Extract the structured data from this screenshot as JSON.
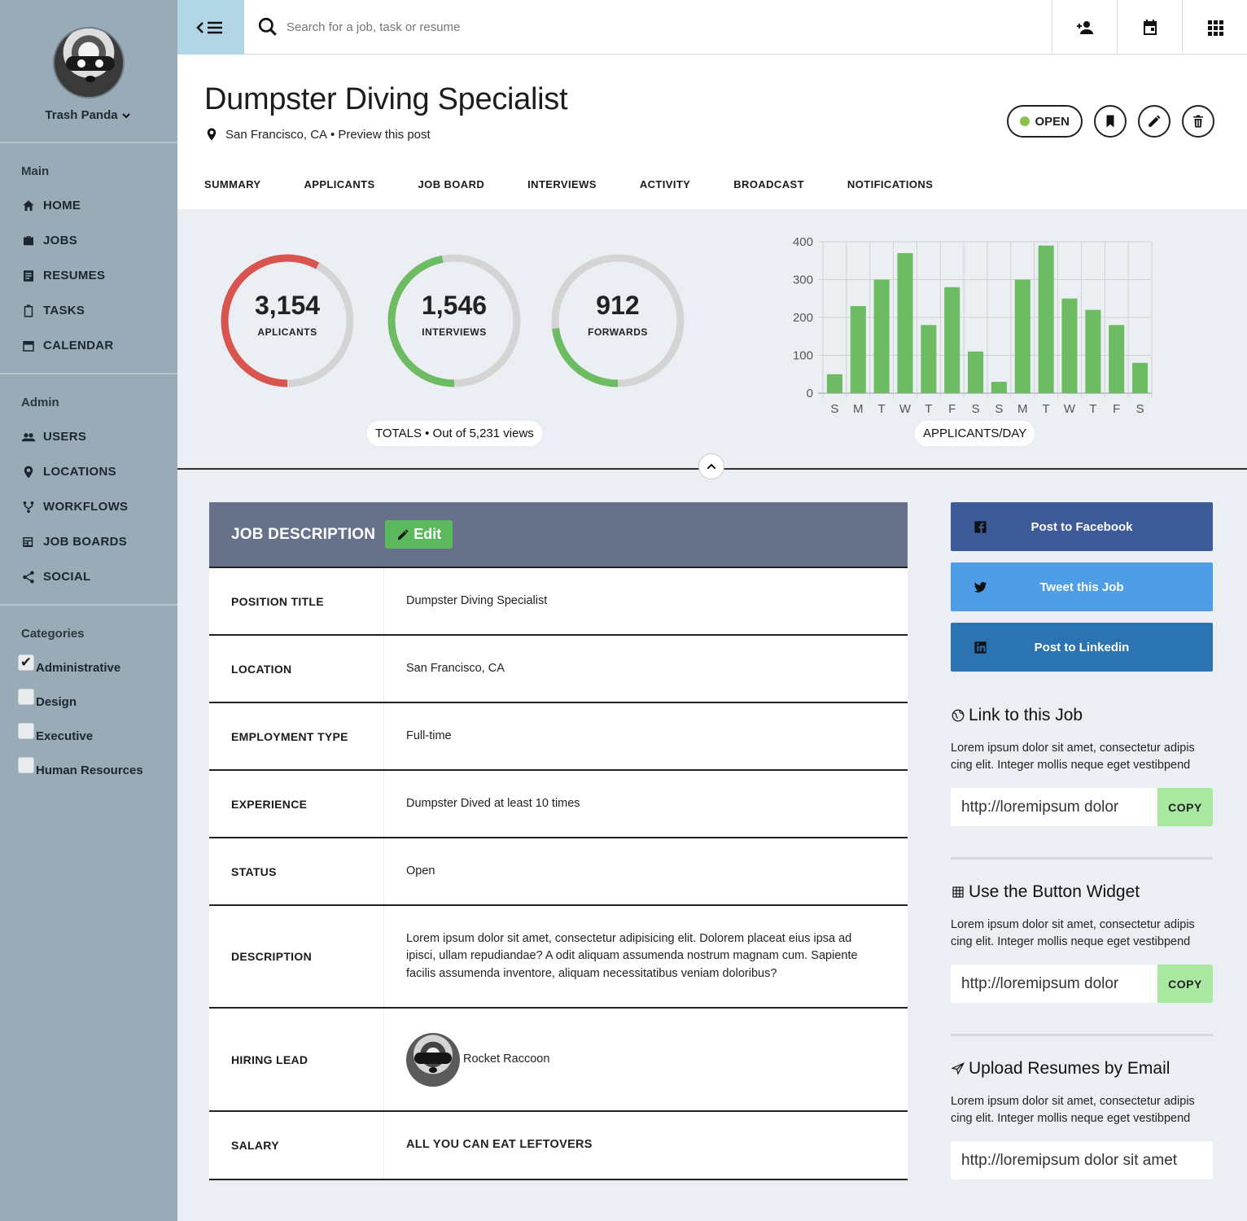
{
  "user": {
    "name": "Trash Panda"
  },
  "sidebar": {
    "main_title": "Main",
    "main_items": [
      {
        "label": "HOME",
        "icon": "home-icon"
      },
      {
        "label": "JOBS",
        "icon": "briefcase-icon"
      },
      {
        "label": "RESUMES",
        "icon": "document-icon"
      },
      {
        "label": "TASKS",
        "icon": "clipboard-icon"
      },
      {
        "label": "CALENDAR",
        "icon": "calendar-icon"
      }
    ],
    "admin_title": "Admin",
    "admin_items": [
      {
        "label": "USERS",
        "icon": "users-icon"
      },
      {
        "label": "LOCATIONS",
        "icon": "location-pin-icon"
      },
      {
        "label": "WORKFLOWS",
        "icon": "workflow-icon"
      },
      {
        "label": "JOB BOARDS",
        "icon": "newspaper-icon"
      },
      {
        "label": "SOCIAL",
        "icon": "share-icon"
      }
    ],
    "categories_title": "Categories",
    "categories": [
      {
        "label": "Administrative",
        "checked": true
      },
      {
        "label": "Design",
        "checked": false
      },
      {
        "label": "Executive",
        "checked": false
      },
      {
        "label": "Human Resources",
        "checked": false
      }
    ]
  },
  "search": {
    "placeholder": "Search for a job, task or resume"
  },
  "header": {
    "title": "Dumpster Diving Specialist",
    "location": "San Francisco, CA",
    "separator": "•",
    "preview_link": "Preview this post",
    "status": "OPEN",
    "status_color": "#8bc34a"
  },
  "tabs": [
    "SUMMARY",
    "APPLICANTS",
    "JOB BOARD",
    "INTERVIEWS",
    "ACTIVITY",
    "BROADCAST",
    "NOTIFICATIONS"
  ],
  "stats": {
    "gauges": [
      {
        "value": "3,154",
        "label": "APLICANTS",
        "color": "#d9534f",
        "fraction": 0.58
      },
      {
        "value": "1,546",
        "label": "INTERVIEWS",
        "color": "#6dbb63",
        "fraction": 0.47
      },
      {
        "value": "912",
        "label": "FORWARDS",
        "color": "#6dbb63",
        "fraction": 0.23
      }
    ],
    "totals_label": "TOTALS • Out of 5,231 views"
  },
  "chart_data": {
    "type": "bar",
    "categories": [
      "S",
      "M",
      "T",
      "W",
      "T",
      "F",
      "S",
      "S",
      "M",
      "T",
      "W",
      "T",
      "F",
      "S"
    ],
    "values": [
      50,
      230,
      300,
      370,
      180,
      280,
      110,
      30,
      300,
      390,
      250,
      220,
      180,
      80
    ],
    "ylim": [
      0,
      400
    ],
    "yticks": [
      0,
      100,
      200,
      300,
      400
    ],
    "xlabel": "APPLICANTS/DAY",
    "grid": true,
    "bar_color": "#6dbb63"
  },
  "job_description": {
    "title": "JOB DESCRIPTION",
    "edit_label": "Edit",
    "rows": [
      {
        "label": "POSITION TITLE",
        "value": "Dumpster Diving Specialist"
      },
      {
        "label": "LOCATION",
        "value": "San Francisco, CA"
      },
      {
        "label": "EMPLOYMENT TYPE",
        "value": "Full-time"
      },
      {
        "label": "EXPERIENCE",
        "value": "Dumpster Dived at least 10 times"
      },
      {
        "label": "STATUS",
        "value": "Open"
      },
      {
        "label": "DESCRIPTION",
        "value": "Lorem ipsum dolor sit amet, consectetur adipisicing elit. Dolorem placeat eius ipsa ad ipisci, ullam repudiandae? A odit aliquam assumenda nostrum magnam cum. Sapiente facilis assumenda inventore, aliquam necessitatibus veniam doloribus?"
      },
      {
        "label": "HIRING LEAD",
        "value": "Rocket Raccoon"
      },
      {
        "label": "SALARY",
        "value": "ALL YOU CAN EAT LEFTOVERS"
      }
    ]
  },
  "social": {
    "facebook": "Post to Facebook",
    "twitter": "Tweet this Job",
    "linkedin": "Post to Linkedin"
  },
  "widgets": [
    {
      "title": "Link to this Job",
      "icon": "globe-icon",
      "text": "Lorem ipsum dolor sit amet, consectetur adipis cing elit. Integer mollis neque eget vestibpend",
      "url": "http://loremipsum dolor",
      "copy": "COPY"
    },
    {
      "title": "Use the Button Widget",
      "icon": "grid-icon",
      "text": "Lorem ipsum dolor sit amet, consectetur adipis cing elit. Integer mollis neque eget vestibpend",
      "url": "http://loremipsum dolor",
      "copy": "COPY"
    },
    {
      "title": "Upload Resumes by Email",
      "icon": "paper-plane-icon",
      "text": "Lorem ipsum dolor sit amet, consectetur adipis cing elit. Integer mollis neque eget vestibpend",
      "url": "http://loremipsum dolor sit amet"
    }
  ]
}
